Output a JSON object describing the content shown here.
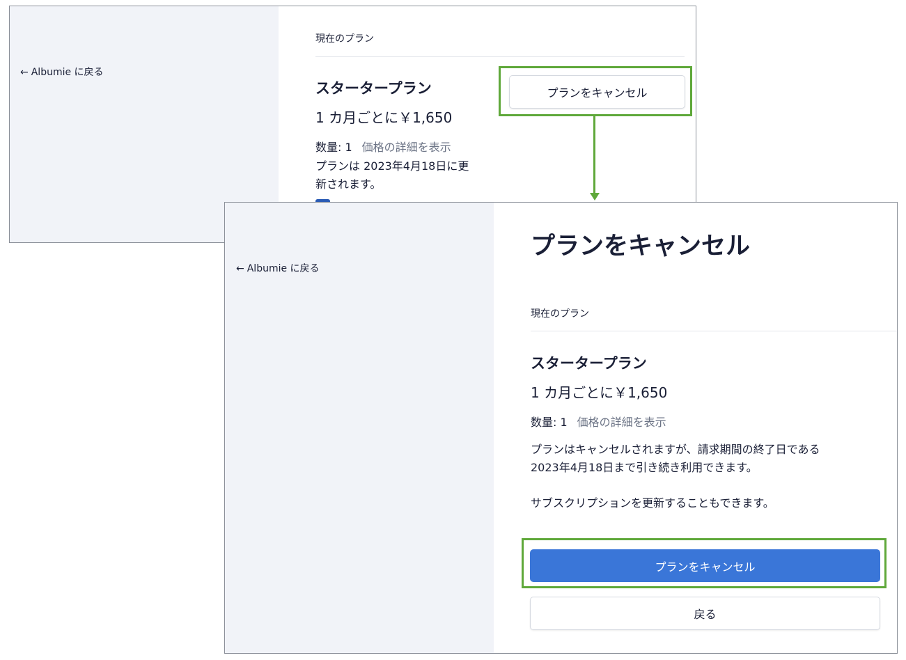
{
  "screen1": {
    "back_link": "Albumie に戻る",
    "caption": "現在のプラン",
    "plan_name": "スタータープラン",
    "price": "1 カ月ごとに￥1,650",
    "quantity_label": "数量: 1",
    "price_details_link": "価格の詳細を表示",
    "renewal_line1": "プランは 2023年4月18日に更",
    "renewal_line2": "新されます。",
    "cancel_button": "プランをキャンセル"
  },
  "screen2": {
    "back_link": "Albumie に戻る",
    "title": "プランをキャンセル",
    "caption": "現在のプラン",
    "plan_name": "スタータープラン",
    "price": "1 カ月ごとに￥1,650",
    "quantity_label": "数量: 1",
    "price_details_link": "価格の詳細を表示",
    "notice_line1": "プランはキャンセルされますが、請求期間の終了日である",
    "notice_line2": "2023年4月18日まで引き続き利用できます。",
    "renew_note": "サブスクリプションを更新することもできます。",
    "confirm_cancel_button": "プランをキャンセル",
    "back_button": "戻る"
  },
  "colors": {
    "highlight": "#5fa83a",
    "primary": "#3a76d8",
    "sidebar": "#f1f3f8",
    "text": "#1a1f36",
    "link": "#6b7385"
  },
  "icons": [
    "arrow-left-icon"
  ]
}
